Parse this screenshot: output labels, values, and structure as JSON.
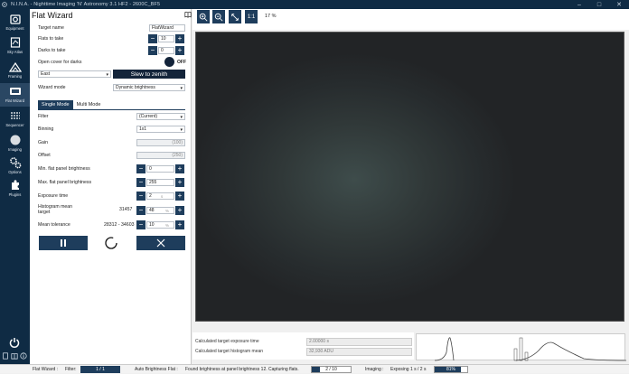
{
  "window": {
    "title": "N.I.N.A. - Nighttime Imaging 'N' Astronomy 3.1 HF2   -   2600C_BF5"
  },
  "sidebar": {
    "items": [
      {
        "label": "Equipment"
      },
      {
        "label": "Sky Atlas"
      },
      {
        "label": "Framing"
      },
      {
        "label": "Flat Wizard"
      },
      {
        "label": "Sequencer"
      },
      {
        "label": "Imaging"
      },
      {
        "label": "Options"
      },
      {
        "label": "Plugins"
      }
    ]
  },
  "panel": {
    "title": "Flat Wizard",
    "target_name": {
      "label": "Target name",
      "value": "FlatWizard"
    },
    "flats_to_take": {
      "label": "Flats to take",
      "value": "10"
    },
    "darks_to_take": {
      "label": "Darks to take",
      "value": "0"
    },
    "open_cover": {
      "label": "Open cover for darks",
      "state": "OFF"
    },
    "direction": {
      "value": "East"
    },
    "slew_button": "Slew to zenith",
    "wizard_mode": {
      "label": "Wizard mode",
      "value": "Dynamic brightness"
    },
    "tabs": [
      {
        "label": "Single Mode"
      },
      {
        "label": "Multi Mode"
      }
    ],
    "filter": {
      "label": "Filter",
      "value": "(Current)"
    },
    "binning": {
      "label": "Binning",
      "value": "1x1"
    },
    "gain": {
      "label": "Gain",
      "value": "(100)"
    },
    "offset": {
      "label": "Offset",
      "value": "(250)"
    },
    "min_flat": {
      "label": "Min. flat panel brightness",
      "value": "0"
    },
    "max_flat": {
      "label": "Max. flat panel brightness",
      "value": "255"
    },
    "exposure": {
      "label": "Exposure time",
      "value": "2",
      "unit": "s"
    },
    "hist_mean": {
      "label_1": "Histogram mean",
      "label_2": "target",
      "readout": "31457",
      "value": "48",
      "unit": "%"
    },
    "tolerance": {
      "label": "Mean tolerance",
      "readout": "28312 - 34603",
      "value": "10",
      "unit": "%"
    }
  },
  "toolbar": {
    "fit_label": "1:1",
    "zoom": "17 %"
  },
  "stats": {
    "exposure": {
      "label": "Calculated target exposure time",
      "value": "2.00000 s"
    },
    "mean": {
      "label": "Calculated target histogram mean",
      "value": "32,930 ADU"
    }
  },
  "statusbar": {
    "flat_wizard": "Flat Wizard :",
    "filter_label": "Filter:",
    "filter_progress": "1 / 1",
    "auto_brightness": "Auto Brightness Flat :",
    "found_msg": "Found brightness at panel brightness 12. Capturing flats.",
    "flat_progress": "2 / 10",
    "flat_progress_fraction": 0.2,
    "imaging_label": "Imaging :",
    "exposing": "Exposing 1 s / 2 s",
    "exposing_percent": "81%",
    "exposing_fraction": 0.81
  },
  "colors": {
    "sidebar": "#0f2b44",
    "accent": "#1e3d5c",
    "accent_dark": "#13243a"
  }
}
